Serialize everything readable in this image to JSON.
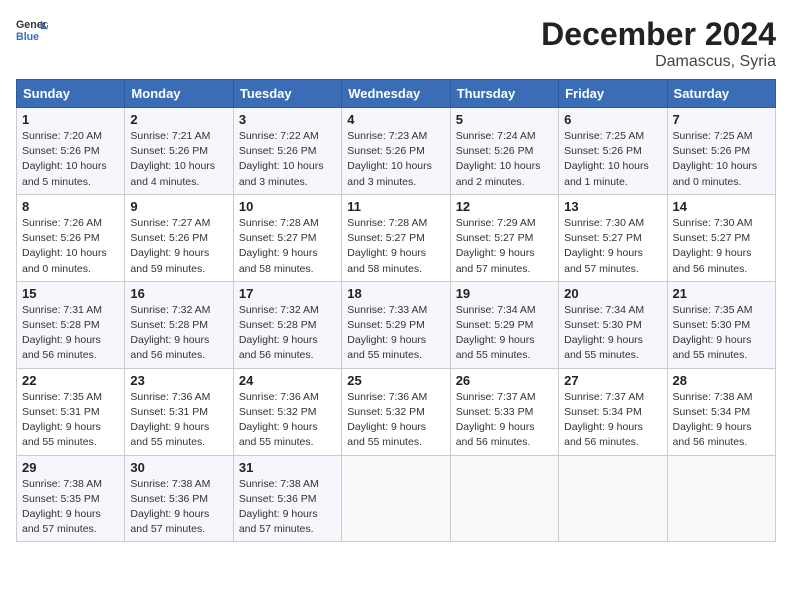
{
  "header": {
    "logo_line1": "General",
    "logo_line2": "Blue",
    "month": "December 2024",
    "location": "Damascus, Syria"
  },
  "weekdays": [
    "Sunday",
    "Monday",
    "Tuesday",
    "Wednesday",
    "Thursday",
    "Friday",
    "Saturday"
  ],
  "weeks": [
    [
      {
        "day": "1",
        "sunrise": "7:20 AM",
        "sunset": "5:26 PM",
        "daylight": "10 hours and 5 minutes."
      },
      {
        "day": "2",
        "sunrise": "7:21 AM",
        "sunset": "5:26 PM",
        "daylight": "10 hours and 4 minutes."
      },
      {
        "day": "3",
        "sunrise": "7:22 AM",
        "sunset": "5:26 PM",
        "daylight": "10 hours and 3 minutes."
      },
      {
        "day": "4",
        "sunrise": "7:23 AM",
        "sunset": "5:26 PM",
        "daylight": "10 hours and 3 minutes."
      },
      {
        "day": "5",
        "sunrise": "7:24 AM",
        "sunset": "5:26 PM",
        "daylight": "10 hours and 2 minutes."
      },
      {
        "day": "6",
        "sunrise": "7:25 AM",
        "sunset": "5:26 PM",
        "daylight": "10 hours and 1 minute."
      },
      {
        "day": "7",
        "sunrise": "7:25 AM",
        "sunset": "5:26 PM",
        "daylight": "10 hours and 0 minutes."
      }
    ],
    [
      {
        "day": "8",
        "sunrise": "7:26 AM",
        "sunset": "5:26 PM",
        "daylight": "10 hours and 0 minutes."
      },
      {
        "day": "9",
        "sunrise": "7:27 AM",
        "sunset": "5:26 PM",
        "daylight": "9 hours and 59 minutes."
      },
      {
        "day": "10",
        "sunrise": "7:28 AM",
        "sunset": "5:27 PM",
        "daylight": "9 hours and 58 minutes."
      },
      {
        "day": "11",
        "sunrise": "7:28 AM",
        "sunset": "5:27 PM",
        "daylight": "9 hours and 58 minutes."
      },
      {
        "day": "12",
        "sunrise": "7:29 AM",
        "sunset": "5:27 PM",
        "daylight": "9 hours and 57 minutes."
      },
      {
        "day": "13",
        "sunrise": "7:30 AM",
        "sunset": "5:27 PM",
        "daylight": "9 hours and 57 minutes."
      },
      {
        "day": "14",
        "sunrise": "7:30 AM",
        "sunset": "5:27 PM",
        "daylight": "9 hours and 56 minutes."
      }
    ],
    [
      {
        "day": "15",
        "sunrise": "7:31 AM",
        "sunset": "5:28 PM",
        "daylight": "9 hours and 56 minutes."
      },
      {
        "day": "16",
        "sunrise": "7:32 AM",
        "sunset": "5:28 PM",
        "daylight": "9 hours and 56 minutes."
      },
      {
        "day": "17",
        "sunrise": "7:32 AM",
        "sunset": "5:28 PM",
        "daylight": "9 hours and 56 minutes."
      },
      {
        "day": "18",
        "sunrise": "7:33 AM",
        "sunset": "5:29 PM",
        "daylight": "9 hours and 55 minutes."
      },
      {
        "day": "19",
        "sunrise": "7:34 AM",
        "sunset": "5:29 PM",
        "daylight": "9 hours and 55 minutes."
      },
      {
        "day": "20",
        "sunrise": "7:34 AM",
        "sunset": "5:30 PM",
        "daylight": "9 hours and 55 minutes."
      },
      {
        "day": "21",
        "sunrise": "7:35 AM",
        "sunset": "5:30 PM",
        "daylight": "9 hours and 55 minutes."
      }
    ],
    [
      {
        "day": "22",
        "sunrise": "7:35 AM",
        "sunset": "5:31 PM",
        "daylight": "9 hours and 55 minutes."
      },
      {
        "day": "23",
        "sunrise": "7:36 AM",
        "sunset": "5:31 PM",
        "daylight": "9 hours and 55 minutes."
      },
      {
        "day": "24",
        "sunrise": "7:36 AM",
        "sunset": "5:32 PM",
        "daylight": "9 hours and 55 minutes."
      },
      {
        "day": "25",
        "sunrise": "7:36 AM",
        "sunset": "5:32 PM",
        "daylight": "9 hours and 55 minutes."
      },
      {
        "day": "26",
        "sunrise": "7:37 AM",
        "sunset": "5:33 PM",
        "daylight": "9 hours and 56 minutes."
      },
      {
        "day": "27",
        "sunrise": "7:37 AM",
        "sunset": "5:34 PM",
        "daylight": "9 hours and 56 minutes."
      },
      {
        "day": "28",
        "sunrise": "7:38 AM",
        "sunset": "5:34 PM",
        "daylight": "9 hours and 56 minutes."
      }
    ],
    [
      {
        "day": "29",
        "sunrise": "7:38 AM",
        "sunset": "5:35 PM",
        "daylight": "9 hours and 57 minutes."
      },
      {
        "day": "30",
        "sunrise": "7:38 AM",
        "sunset": "5:36 PM",
        "daylight": "9 hours and 57 minutes."
      },
      {
        "day": "31",
        "sunrise": "7:38 AM",
        "sunset": "5:36 PM",
        "daylight": "9 hours and 57 minutes."
      },
      null,
      null,
      null,
      null
    ]
  ]
}
